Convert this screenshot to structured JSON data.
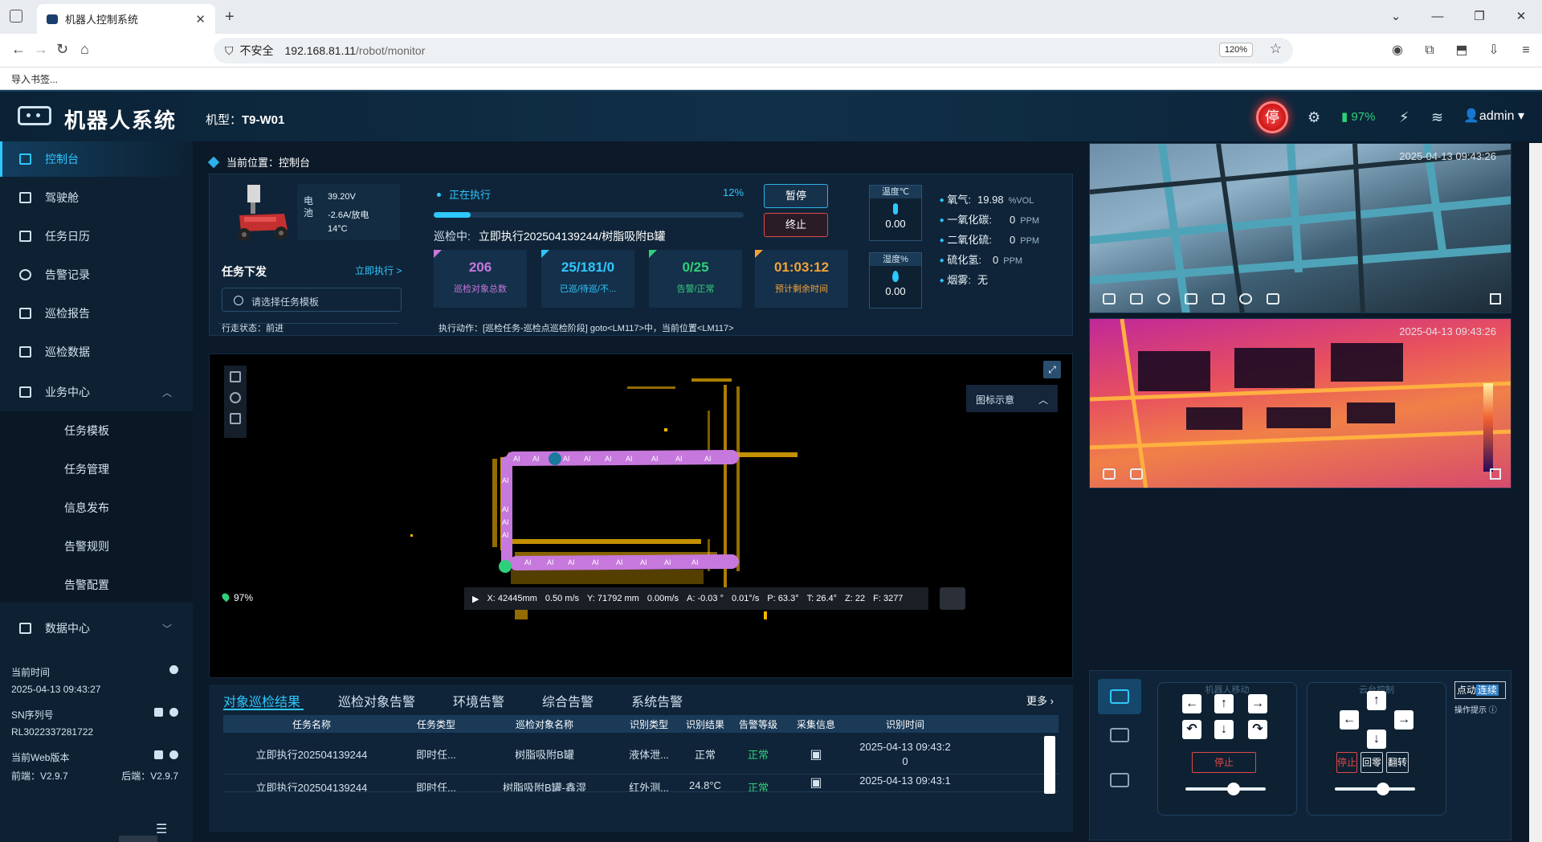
{
  "browser": {
    "tab_title": "机器人控制系统",
    "insecure_label": "不安全",
    "url_host": "192.168.81.11",
    "url_path": "/robot/monitor",
    "zoom": "120%",
    "bookmark": "导入书签..."
  },
  "header": {
    "title": "机器人系统",
    "model_label": "机型：",
    "model": "T9-W01",
    "estop": "停",
    "battery": "97%",
    "user": "admin"
  },
  "sidebar": {
    "items": [
      {
        "label": "控制台"
      },
      {
        "label": "驾驶舱"
      },
      {
        "label": "任务日历"
      },
      {
        "label": "告警记录"
      },
      {
        "label": "巡检报告"
      },
      {
        "label": "巡检数据"
      },
      {
        "label": "业务中心"
      }
    ],
    "sub_items": [
      {
        "label": "任务模板"
      },
      {
        "label": "任务管理"
      },
      {
        "label": "信息发布"
      },
      {
        "label": "告警规则"
      },
      {
        "label": "告警配置"
      }
    ],
    "data_center": "数据中心",
    "info": {
      "time_label": "当前时间",
      "time": "2025-04-13 09:43:27",
      "sn_label": "SN序列号",
      "sn": "RL3022337281722",
      "web_label": "当前Web版本",
      "front": "前端：V2.9.7",
      "back": "后端：V2.9.7"
    }
  },
  "breadcrumb": "当前位置：控制台",
  "robot": {
    "battery_label": "电池",
    "voltage": "39.20V",
    "current": "-2.6A/放电",
    "temp": "14°C"
  },
  "task": {
    "title": "任务下发",
    "exec_now": "立即执行 >",
    "template_placeholder": "请选择任务模板",
    "status": "正在执行",
    "progress_text": "12%",
    "progress": 0.12,
    "patrol_label": "巡检中:",
    "patrol_name": "立即执行202504139244/树脂吸附B罐",
    "pause": "暂停",
    "stop": "终止",
    "walk_label": "行走状态：",
    "walk_value": "前进",
    "action_label": "执行动作：",
    "action_value": "[巡检任务-巡检点巡检阶段] goto<LM117>中，当前位置<LM117>"
  },
  "stats": [
    {
      "value": "206",
      "label": "巡检对象总数",
      "color": "#c678dd"
    },
    {
      "value": "25/181/0",
      "label": "已巡/待巡/不...",
      "color": "#2ec7ff"
    },
    {
      "value": "0/25",
      "label": "告警/正常",
      "color": "#2fd07a"
    },
    {
      "value": "01:03:12",
      "label": "预计剩余时间",
      "color": "#f2a33a"
    }
  ],
  "sensors": {
    "temp_label": "温度℃",
    "temp_value": "0.00",
    "hum_label": "湿度%",
    "hum_value": "0.00",
    "gases": [
      {
        "name": "氧气:",
        "value": "19.98",
        "unit": "%VOL"
      },
      {
        "name": "一氧化碳:",
        "value": "0",
        "unit": "PPM"
      },
      {
        "name": "二氧化硫:",
        "value": "0",
        "unit": "PPM"
      },
      {
        "name": "硫化氢:",
        "value": "0",
        "unit": "PPM"
      },
      {
        "name": "烟雾:",
        "value": "无",
        "unit": ""
      }
    ]
  },
  "map": {
    "legend": "图标示意",
    "battery": "97%",
    "coords": {
      "x": "X:  42445mm",
      "vx": "0.50 m/s",
      "y": "Y:  71792 mm",
      "vy": "0.00m/s",
      "a": "A:  -0.03 °",
      "va": "0.01°/s",
      "p": "P:  63.3°",
      "t": "T:  26.4°",
      "z": "Z:  22",
      "f": "F:  3277"
    }
  },
  "cameras": {
    "visible_ts": "2025-04-13 09:43:26",
    "thermal_ts": "2025-04-13 09:43:26"
  },
  "control": {
    "move_title": "机器人移动",
    "ptz_title": "云台控制",
    "stop": "停止",
    "ptz_stop": "停止",
    "ptz_home": "回零",
    "ptz_flip": "翻转",
    "mode_a": "点动",
    "mode_b": "连续",
    "hint": "操作提示",
    "move_speed": 0.6,
    "ptz_speed": 0.6
  },
  "results": {
    "tabs": [
      "对象巡检结果",
      "巡检对象告警",
      "环境告警",
      "综合告警",
      "系统告警"
    ],
    "more": "更多",
    "columns": [
      "任务名称",
      "任务类型",
      "巡检对象名称",
      "识别类型",
      "识别结果",
      "告警等级",
      "采集信息",
      "识别时间"
    ],
    "rows": [
      {
        "task": "立即执行202504139244",
        "type": "即时任...",
        "object": "树脂吸附B罐",
        "kind": "液体泄...",
        "result": "正常",
        "level": "正常",
        "time1": "2025-04-13 09:43:2",
        "time2": "0"
      },
      {
        "task": "立即执行202504139244",
        "type": "即时任...",
        "object": "树脂吸附B罐-鑫湿",
        "kind": "红外测...",
        "result": "24.8°C",
        "level": "正常",
        "time1": "2025-04-13 09:43:1",
        "time2": ""
      }
    ]
  }
}
